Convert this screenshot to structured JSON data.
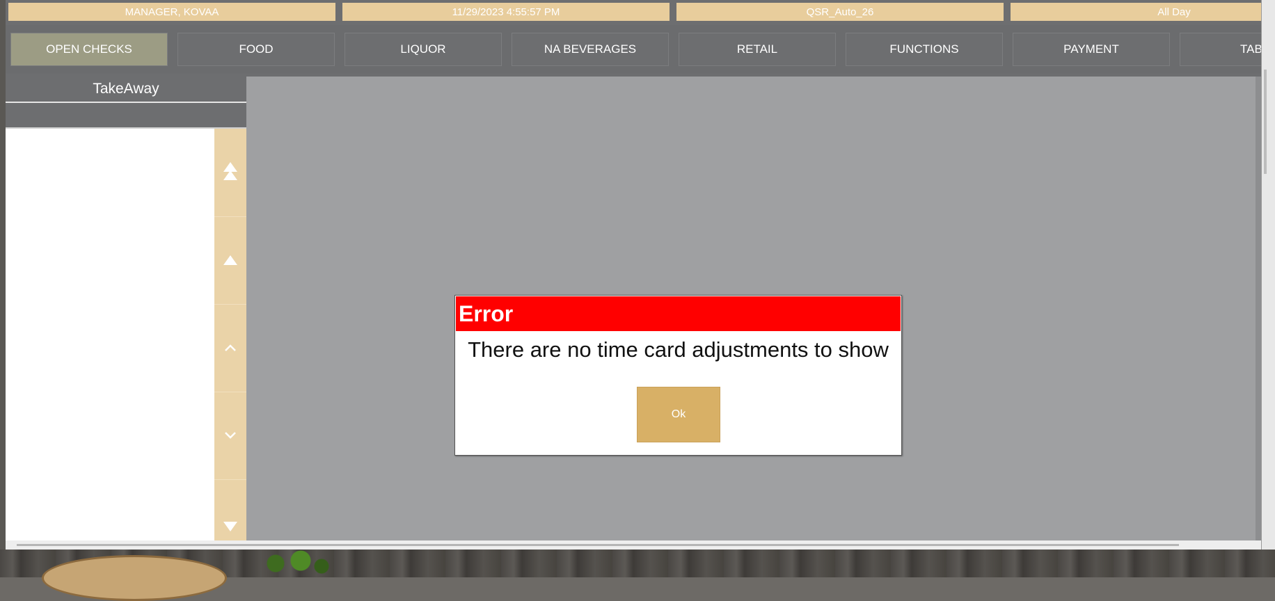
{
  "status_bar": {
    "user": "MANAGER, KOVAA",
    "datetime": "11/29/2023 4:55:57 PM",
    "terminal": "QSR_Auto_26",
    "daypart": "All Day"
  },
  "categories": [
    {
      "label": "OPEN CHECKS",
      "active": true
    },
    {
      "label": "FOOD"
    },
    {
      "label": "LIQUOR"
    },
    {
      "label": "NA BEVERAGES"
    },
    {
      "label": "RETAIL"
    },
    {
      "label": "FUNCTIONS"
    },
    {
      "label": "PAYMENT"
    },
    {
      "label": "TABL"
    }
  ],
  "left_panel": {
    "title": "TakeAway",
    "scroll_buttons": [
      "double-up-arrow-icon",
      "up-triangle-icon",
      "chevron-up-icon",
      "chevron-down-icon",
      "down-triangle-icon"
    ]
  },
  "dialog": {
    "title": "Error",
    "message": "There are no time card adjustments to show",
    "ok_label": "Ok"
  },
  "colors": {
    "status_bg": "#e8cd9c",
    "active_tab": "#9c9c84",
    "dialog_title_bg": "#ff0000",
    "ok_button_bg": "#d8b066"
  }
}
